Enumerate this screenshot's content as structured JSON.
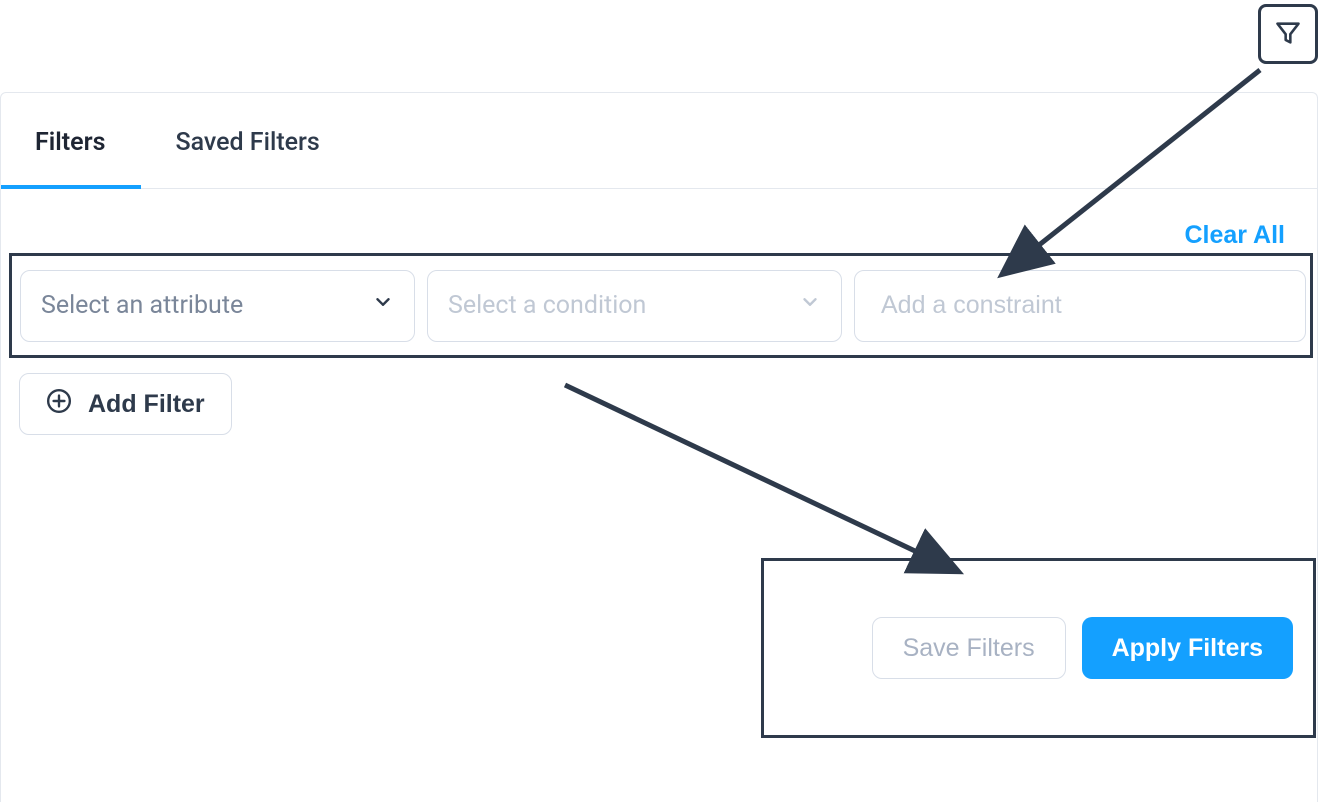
{
  "tabs": {
    "filters": "Filters",
    "saved": "Saved Filters"
  },
  "clearAll": "Clear All",
  "filterRow": {
    "attributePlaceholder": "Select an attribute",
    "conditionPlaceholder": "Select a condition",
    "constraintPlaceholder": "Add a constraint"
  },
  "addFilter": "Add Filter",
  "actions": {
    "save": "Save Filters",
    "apply": "Apply Filters"
  }
}
